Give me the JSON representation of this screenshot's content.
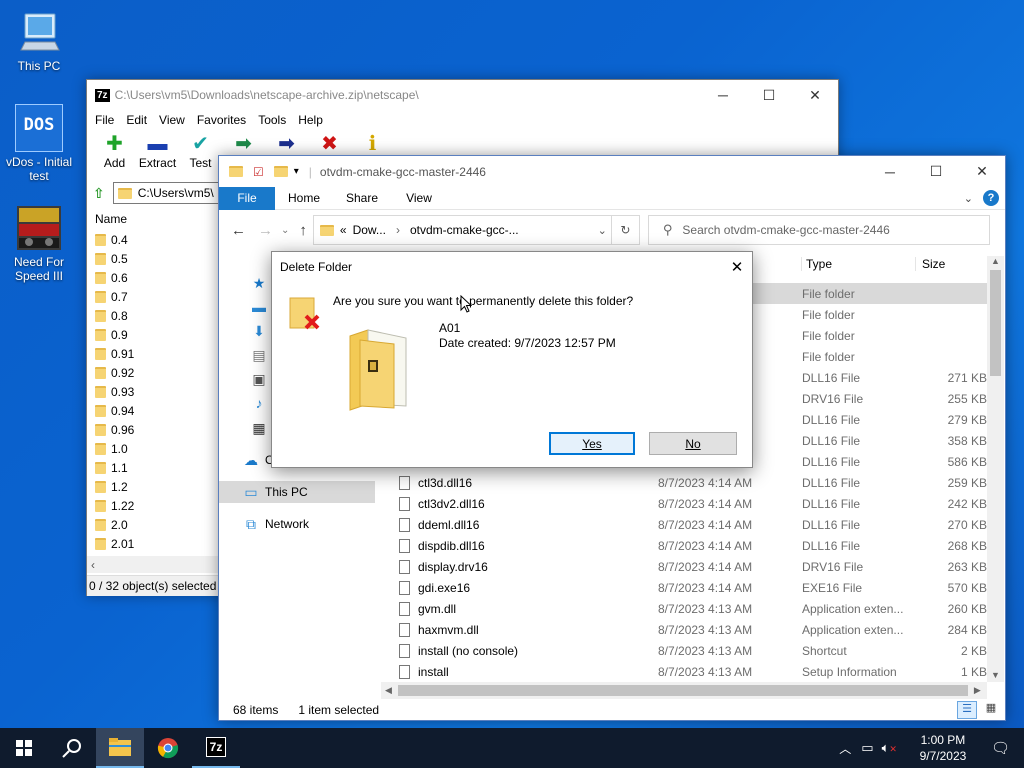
{
  "desktop": {
    "icons": [
      {
        "label": "This PC",
        "icon": "computer-icon"
      },
      {
        "label": "vDos - Initial test",
        "icon": "dos-icon"
      },
      {
        "label": "Need For Speed III",
        "icon": "game-icon"
      }
    ],
    "dos_text": "DOS"
  },
  "sevenzip": {
    "title": "C:\\Users\\vm5\\Downloads\\netscape-archive.zip\\netscape\\",
    "app_badge": "7z",
    "menu": [
      "File",
      "Edit",
      "View",
      "Favorites",
      "Tools",
      "Help"
    ],
    "toolbar": [
      {
        "label": "Add",
        "glyph": "✚",
        "color": "#1fa32a"
      },
      {
        "label": "Extract",
        "glyph": "▬",
        "color": "#1a3fb0"
      },
      {
        "label": "Test",
        "glyph": "✔",
        "color": "#19a3a3"
      },
      {
        "label": "",
        "glyph": "➡",
        "color": "#1e8a4a"
      },
      {
        "label": "",
        "glyph": "➡",
        "color": "#1c2f8f"
      },
      {
        "label": "",
        "glyph": "✖",
        "color": "#d01515"
      },
      {
        "label": "",
        "glyph": "ℹ",
        "color": "#d4a800"
      }
    ],
    "path_value": "C:\\Users\\vm5\\",
    "column_name": "Name",
    "folders": [
      "0.4",
      "0.5",
      "0.6",
      "0.7",
      "0.8",
      "0.9",
      "0.91",
      "0.92",
      "0.93",
      "0.94",
      "0.96",
      "1.0",
      "1.1",
      "1.2",
      "1.22",
      "2.0",
      "2.01"
    ],
    "status": "0 / 32 object(s) selected"
  },
  "explorer": {
    "title": "otvdm-cmake-gcc-master-2446",
    "ribbon_tabs": [
      "File",
      "Home",
      "Share",
      "View"
    ],
    "breadcrumb": [
      "Dow...",
      "otvdm-cmake-gcc-..."
    ],
    "breadcrumb_prefix": "«",
    "search_placeholder": "Search otvdm-cmake-gcc-master-2446",
    "columns": {
      "type": "Type",
      "size": "Size"
    },
    "nav": [
      {
        "label": "Q",
        "icon": "star-icon"
      },
      {
        "label": "",
        "icon": "desktop-icon"
      },
      {
        "label": "",
        "icon": "download-icon"
      },
      {
        "label": "",
        "icon": "document-icon"
      },
      {
        "label": "",
        "icon": "pictures-icon"
      },
      {
        "label": "",
        "icon": "music-icon"
      },
      {
        "label": "",
        "icon": "video-icon"
      },
      {
        "label": "O",
        "icon": "onedrive-icon"
      },
      {
        "label": "This PC",
        "icon": "computer-icon"
      },
      {
        "label": "Network",
        "icon": "network-icon"
      }
    ],
    "upper_rows": [
      {
        "type": "File folder",
        "size": ""
      },
      {
        "type": "File folder",
        "size": ""
      },
      {
        "type": "File folder",
        "size": ""
      },
      {
        "type": "File folder",
        "size": ""
      },
      {
        "type": "DLL16 File",
        "size": "271 KB"
      },
      {
        "type": "DRV16 File",
        "size": "255 KB"
      },
      {
        "type": "DLL16 File",
        "size": "279 KB"
      },
      {
        "type": "DLL16 File",
        "size": "358 KB"
      },
      {
        "type": "DLL16 File",
        "size": "586 KB"
      }
    ],
    "rows": [
      {
        "name": "ctl3d.dll16",
        "date": "8/7/2023 4:14 AM",
        "type": "DLL16 File",
        "size": "259 KB"
      },
      {
        "name": "ctl3dv2.dll16",
        "date": "8/7/2023 4:14 AM",
        "type": "DLL16 File",
        "size": "242 KB"
      },
      {
        "name": "ddeml.dll16",
        "date": "8/7/2023 4:14 AM",
        "type": "DLL16 File",
        "size": "270 KB"
      },
      {
        "name": "dispdib.dll16",
        "date": "8/7/2023 4:14 AM",
        "type": "DLL16 File",
        "size": "268 KB"
      },
      {
        "name": "display.drv16",
        "date": "8/7/2023 4:14 AM",
        "type": "DRV16 File",
        "size": "263 KB"
      },
      {
        "name": "gdi.exe16",
        "date": "8/7/2023 4:14 AM",
        "type": "EXE16 File",
        "size": "570 KB"
      },
      {
        "name": "gvm.dll",
        "date": "8/7/2023 4:13 AM",
        "type": "Application exten...",
        "size": "260 KB"
      },
      {
        "name": "haxmvm.dll",
        "date": "8/7/2023 4:13 AM",
        "type": "Application exten...",
        "size": "284 KB"
      },
      {
        "name": "install (no console)",
        "date": "8/7/2023 4:13 AM",
        "type": "Shortcut",
        "size": "2 KB"
      },
      {
        "name": "install",
        "date": "8/7/2023 4:13 AM",
        "type": "Setup Information",
        "size": "1 KB"
      }
    ],
    "status_items": "68 items",
    "status_selected": "1 item selected"
  },
  "dialog": {
    "title": "Delete Folder",
    "question": "Are you sure you want to permanently delete this folder?",
    "folder_name": "A01",
    "date_created": "Date created: 9/7/2023 12:57 PM",
    "yes_label": "Yes",
    "no_label": "No"
  },
  "taskbar": {
    "time": "1:00 PM",
    "date": "9/7/2023",
    "apps": [
      "start-icon",
      "search-icon",
      "file-explorer-icon",
      "chrome-icon",
      "7zip-icon"
    ],
    "sevenzip_badge": "7z"
  },
  "colors": {
    "accent": "#0063b1",
    "selection": "#cce8ff",
    "desktop": "#0a63d0",
    "taskbar": "#0f1b2d"
  }
}
